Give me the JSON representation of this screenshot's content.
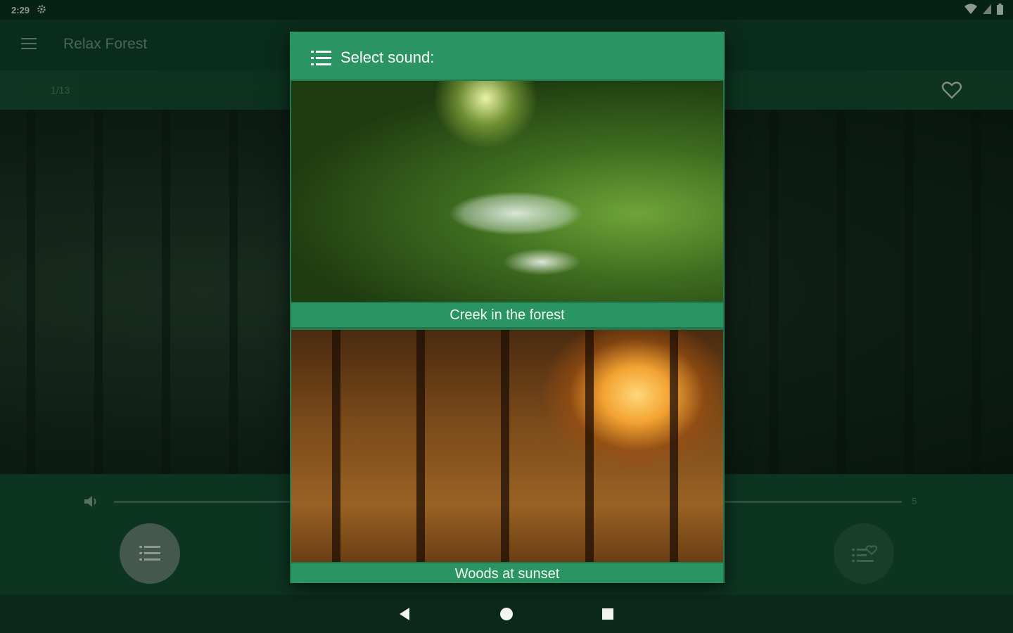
{
  "status_bar": {
    "time": "2:29"
  },
  "app_bar": {
    "title": "Relax Forest"
  },
  "player": {
    "track_counter": "1/13",
    "volume_value": "5"
  },
  "dialog": {
    "title": "Select sound:",
    "items": [
      {
        "caption": "Creek in the forest"
      },
      {
        "caption": "Woods at sunset"
      }
    ]
  }
}
